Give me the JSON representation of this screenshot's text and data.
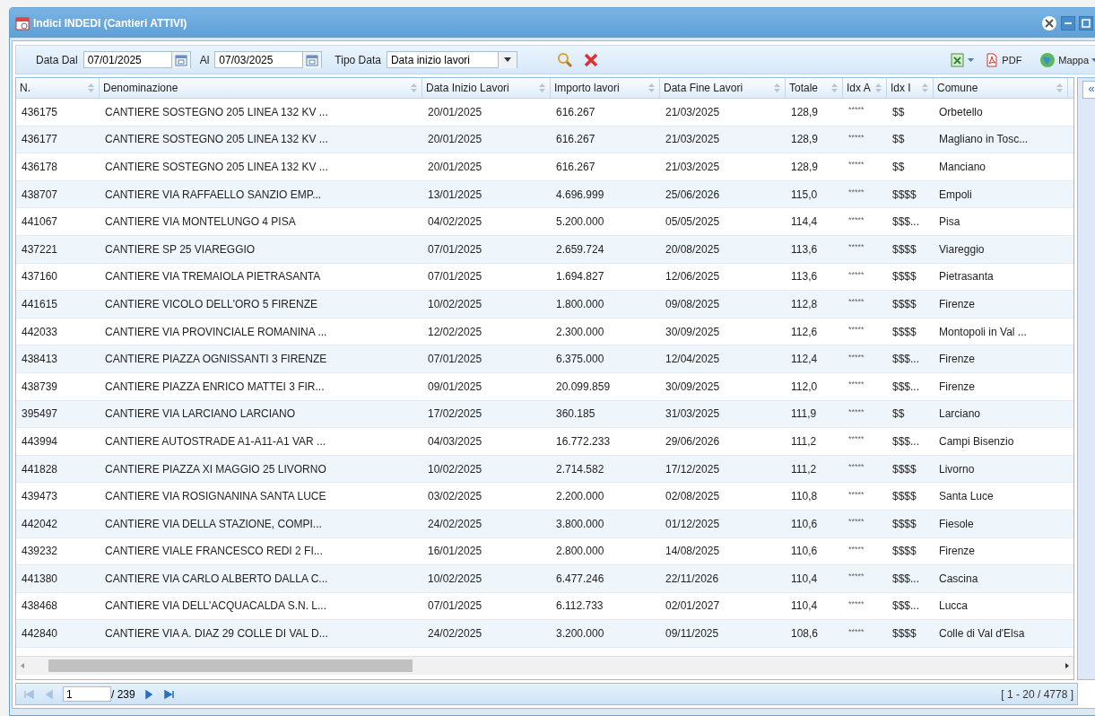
{
  "window": {
    "title": "Indici INDEDI (Cantieri ATTIVI)"
  },
  "filters": {
    "date_from_label": "Data Dal",
    "date_from": "07/01/2025",
    "date_to_label": "Al",
    "date_to": "07/03/2025",
    "type_label": "Tipo Data",
    "type_value": "Data inizio lavori"
  },
  "export": {
    "pdf_label": "PDF",
    "map_label": "Mappa"
  },
  "side_panel": {
    "expand_label": "«"
  },
  "columns": [
    {
      "label": "N."
    },
    {
      "label": "Denominazione"
    },
    {
      "label": "Data Inizio Lavori"
    },
    {
      "label": "Importo lavori"
    },
    {
      "label": "Data Fine Lavori"
    },
    {
      "label": "Totale"
    },
    {
      "label": "Idx A"
    },
    {
      "label": "Idx I"
    },
    {
      "label": "Comune"
    }
  ],
  "rows": [
    {
      "cells": [
        "436175",
        "CANTIERE SOSTEGNO 205 LINEA 132 KV ...",
        "20/01/2025",
        "616.267",
        "21/03/2025",
        "128,9",
        "*****",
        "$$",
        "Orbetello"
      ]
    },
    {
      "cells": [
        "436177",
        "CANTIERE SOSTEGNO 205 LINEA 132 KV ...",
        "20/01/2025",
        "616.267",
        "21/03/2025",
        "128,9",
        "*****",
        "$$",
        "Magliano in Tosc..."
      ]
    },
    {
      "cells": [
        "436178",
        "CANTIERE SOSTEGNO 205 LINEA 132 KV ...",
        "20/01/2025",
        "616.267",
        "21/03/2025",
        "128,9",
        "*****",
        "$$",
        "Manciano"
      ]
    },
    {
      "cells": [
        "438707",
        "CANTIERE VIA RAFFAELLO SANZIO EMP...",
        "13/01/2025",
        "4.696.999",
        "25/06/2026",
        "115,0",
        "*****",
        "$$$$",
        "Empoli"
      ]
    },
    {
      "cells": [
        "441067",
        "CANTIERE VIA MONTELUNGO 4 PISA",
        "04/02/2025",
        "5.200.000",
        "05/05/2025",
        "114,4",
        "*****",
        "$$$...",
        "Pisa"
      ]
    },
    {
      "cells": [
        "437221",
        "CANTIERE SP 25 VIAREGGIO",
        "07/01/2025",
        "2.659.724",
        "20/08/2025",
        "113,6",
        "*****",
        "$$$$",
        "Viareggio"
      ]
    },
    {
      "cells": [
        "437160",
        "CANTIERE VIA TREMAIOLA PIETRASANTA",
        "07/01/2025",
        "1.694.827",
        "12/06/2025",
        "113,6",
        "*****",
        "$$$$",
        "Pietrasanta"
      ]
    },
    {
      "cells": [
        "441615",
        "CANTIERE VICOLO DELL'ORO 5 FIRENZE",
        "10/02/2025",
        "1.800.000",
        "09/08/2025",
        "112,8",
        "*****",
        "$$$$",
        "Firenze"
      ]
    },
    {
      "cells": [
        "442033",
        "CANTIERE VIA PROVINCIALE ROMANINA ...",
        "12/02/2025",
        "2.300.000",
        "30/09/2025",
        "112,6",
        "*****",
        "$$$$",
        "Montopoli in Val ..."
      ]
    },
    {
      "cells": [
        "438413",
        "CANTIERE PIAZZA OGNISSANTI 3 FIRENZE",
        "07/01/2025",
        "6.375.000",
        "12/04/2025",
        "112,4",
        "*****",
        "$$$...",
        "Firenze"
      ]
    },
    {
      "cells": [
        "438739",
        "CANTIERE PIAZZA ENRICO MATTEI 3 FIR...",
        "09/01/2025",
        "20.099.859",
        "30/09/2025",
        "112,0",
        "*****",
        "$$$...",
        "Firenze"
      ]
    },
    {
      "cells": [
        "395497",
        "CANTIERE VIA LARCIANO LARCIANO",
        "17/02/2025",
        "360.185",
        "31/03/2025",
        "111,9",
        "*****",
        "$$",
        "Larciano"
      ]
    },
    {
      "cells": [
        "443994",
        "CANTIERE AUTOSTRADE A1-A11-A1 VAR ...",
        "04/03/2025",
        "16.772.233",
        "29/06/2026",
        "111,2",
        "*****",
        "$$$...",
        "Campi Bisenzio"
      ]
    },
    {
      "cells": [
        "441828",
        "CANTIERE PIAZZA XI MAGGIO 25 LIVORNO",
        "10/02/2025",
        "2.714.582",
        "17/12/2025",
        "111,2",
        "*****",
        "$$$$",
        "Livorno"
      ]
    },
    {
      "cells": [
        "439473",
        "CANTIERE VIA ROSIGNANINA SANTA LUCE",
        "03/02/2025",
        "2.200.000",
        "02/08/2025",
        "110,8",
        "*****",
        "$$$$",
        "Santa Luce"
      ]
    },
    {
      "cells": [
        "442042",
        "CANTIERE VIA DELLA STAZIONE, COMPI...",
        "24/02/2025",
        "3.800.000",
        "01/12/2025",
        "110,6",
        "*****",
        "$$$$",
        "Fiesole"
      ]
    },
    {
      "cells": [
        "439232",
        "CANTIERE VIALE FRANCESCO REDI 2 FI...",
        "16/01/2025",
        "2.800.000",
        "14/08/2025",
        "110,6",
        "*****",
        "$$$$",
        "Firenze"
      ]
    },
    {
      "cells": [
        "441380",
        "CANTIERE VIA CARLO ALBERTO DALLA C...",
        "10/02/2025",
        "6.477.246",
        "22/11/2026",
        "110,4",
        "*****",
        "$$$...",
        "Cascina"
      ]
    },
    {
      "cells": [
        "438468",
        "CANTIERE VIA DELL'ACQUACALDA S.N. L...",
        "07/01/2025",
        "6.112.733",
        "02/01/2027",
        "110,4",
        "*****",
        "$$$...",
        "Lucca"
      ]
    },
    {
      "cells": [
        "442840",
        "CANTIERE VIA A. DIAZ 29 COLLE DI VAL D...",
        "24/02/2025",
        "3.200.000",
        "09/11/2025",
        "108,6",
        "*****",
        "$$$$",
        "Colle di Val d'Elsa"
      ]
    }
  ],
  "pager": {
    "buttons": [
      {
        "kind": "first",
        "disabled": true
      },
      {
        "kind": "prev",
        "disabled": true
      },
      {
        "kind": "next",
        "disabled": false
      },
      {
        "kind": "last",
        "disabled": false
      }
    ],
    "page": "1",
    "of_pages": "/ 239",
    "display": "[ 1 - 20 / 4778 ]"
  }
}
